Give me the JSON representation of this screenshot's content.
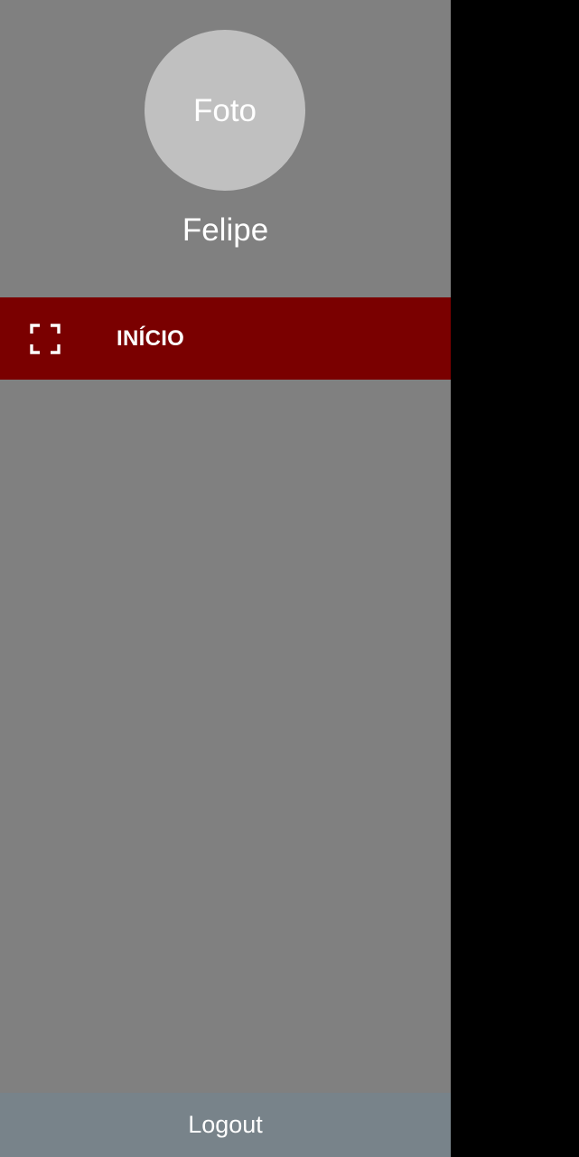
{
  "drawer": {
    "header": {
      "avatar_placeholder": "Foto",
      "user_name": "Felipe"
    },
    "menu": [
      {
        "label": "INÍCIO",
        "icon": "fullscreen-icon",
        "active": true
      }
    ],
    "footer": {
      "logout_label": "Logout"
    }
  },
  "colors": {
    "drawer_background": "#808080",
    "avatar_background": "#c0c0c0",
    "active_item_background": "#7a0000",
    "logout_background": "#78838a",
    "scrim": "#000000",
    "text": "#ffffff"
  }
}
